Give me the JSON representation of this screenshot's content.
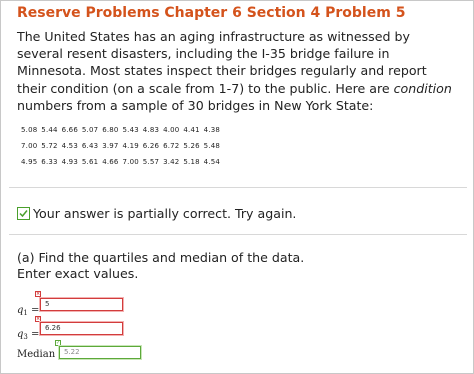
{
  "header": {
    "title": "Reserve Problems Chapter 6 Section 4 Problem 5"
  },
  "problem": {
    "text_before": "The United States has an aging infrastructure as witnessed by several resent disasters, including the I-35 bridge failure in Minnesota. Most states inspect their bridges regularly and report their condition (on a scale from 1-7) to the public. Here are ",
    "emphasis": "condition",
    "text_after": " numbers from a sample of 30 bridges in New York State:",
    "data_rows": [
      [
        "5.08",
        "5.44",
        "6.66",
        "5.07",
        "6.80",
        "5.43",
        "4.83",
        "4.00",
        "4.41",
        "4.38"
      ],
      [
        "7.00",
        "5.72",
        "4.53",
        "6.43",
        "3.97",
        "4.19",
        "6.26",
        "6.72",
        "5.26",
        "5.48"
      ],
      [
        "4.95",
        "6.33",
        "4.93",
        "5.61",
        "4.66",
        "7.00",
        "5.57",
        "3.42",
        "5.18",
        "4.54"
      ]
    ]
  },
  "feedback": {
    "text": "Your answer is partially correct.  Try again.",
    "icon": "partial-check-icon",
    "color": "#4aa02c"
  },
  "question": {
    "line1": "(a) Find the quartiles and median of the data.",
    "line2": "Enter exact values."
  },
  "answers": {
    "q1": {
      "label": "q",
      "sub": "1",
      "eq": " =",
      "value": "5",
      "status": "incorrect"
    },
    "q3": {
      "label": "q",
      "sub": "3",
      "eq": " =",
      "value": "6.26",
      "status": "incorrect"
    },
    "median": {
      "label": "Median =",
      "value": "5.22",
      "status": "correct"
    }
  },
  "colors": {
    "title": "#d4531c",
    "incorrect": "#d23c3c",
    "correct": "#5ca93a"
  }
}
